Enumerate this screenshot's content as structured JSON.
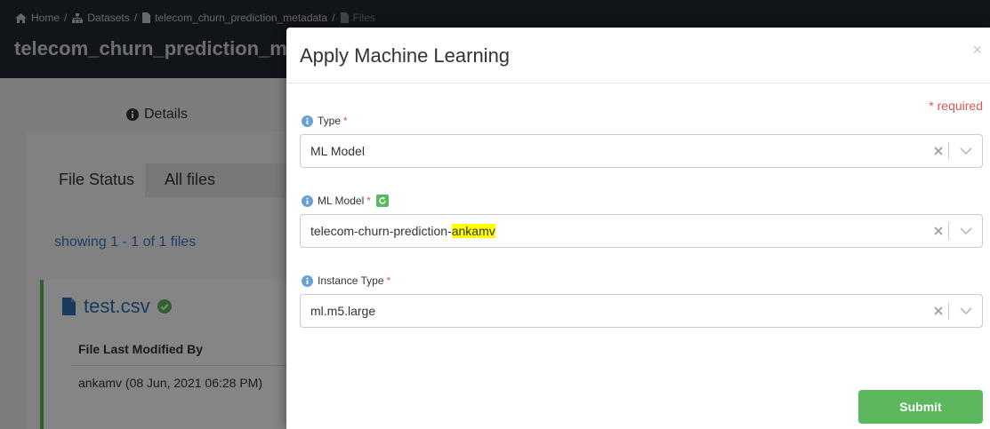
{
  "header": {
    "breadcrumb": [
      {
        "label": "Home",
        "icon": "home-icon"
      },
      {
        "label": "Datasets",
        "icon": "sitemap-icon"
      },
      {
        "label": "telecom_churn_prediction_metadata",
        "icon": "file-icon"
      },
      {
        "label": "Files",
        "icon": "file-icon"
      }
    ],
    "title": "telecom_churn_prediction_m"
  },
  "page": {
    "details_tab": "Details",
    "file_status_label": "File Status",
    "file_status_value": "All files",
    "showing": "showing 1 - 1 of 1 files",
    "file": {
      "name": "test.csv",
      "column_header": "File Last Modified By",
      "column_value": "ankamv (08 Jun, 2021 06:28 PM)"
    }
  },
  "modal": {
    "title": "Apply Machine Learning",
    "close": "×",
    "required_note": "* required",
    "required_mark": "*",
    "fields": {
      "type": {
        "label": "Type",
        "value": "ML Model"
      },
      "ml_model": {
        "label": "ML Model",
        "value_prefix": "telecom-churn-prediction-",
        "value_highlight": "ankamv"
      },
      "instance_type": {
        "label": "Instance Type",
        "value": "ml.m5.large"
      }
    },
    "submit_label": "Submit"
  },
  "colors": {
    "header_bg": "#222830",
    "accent_green": "#5cb85c",
    "link_blue": "#3a78c6",
    "required_red": "#e05555",
    "info_blue": "#6a9fd4",
    "highlight": "#ffff00"
  }
}
